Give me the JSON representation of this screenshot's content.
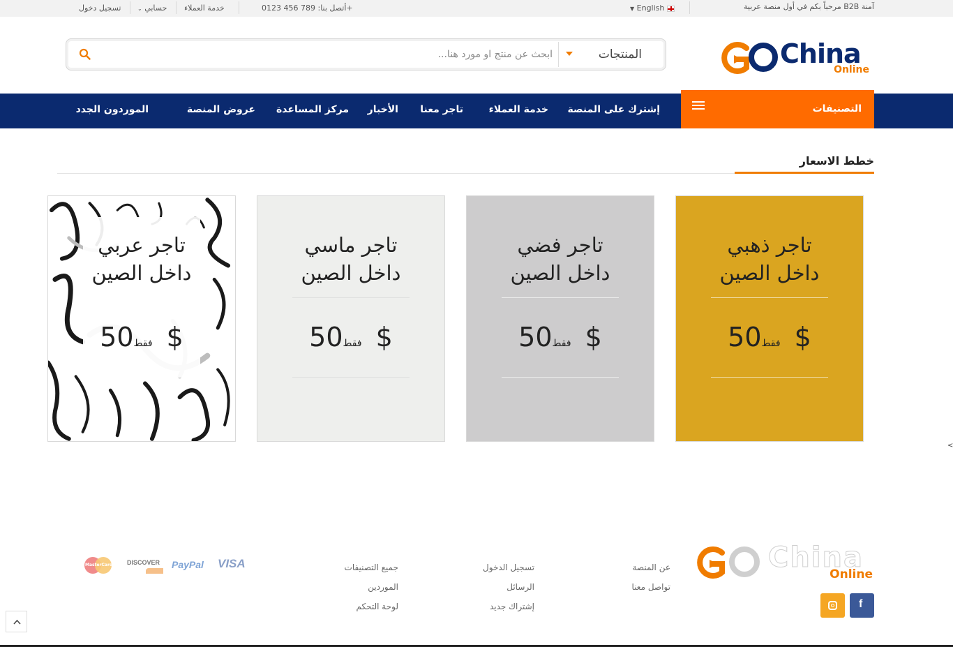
{
  "topbar": {
    "welcome": "مرحباً بكم في أول منصة عربية B2B آمنة",
    "language": "English",
    "contact": "أتصل بنا: 789 456 0123+",
    "customer_service": "خدمة العملاء",
    "my_account": "حسابي",
    "login": "تسجيل دخول"
  },
  "logo": {
    "go": "GO",
    "china": "China",
    "online": "Online"
  },
  "search": {
    "category": "المنتجات",
    "placeholder": "ابحث عن منتج او مورد هنا..."
  },
  "nav": {
    "categories": "التصنيفات",
    "items": [
      "إشترك على المنصة",
      "خدمة العملاء",
      "تاجر معنا",
      "الأخبار",
      "مركز المساعدة",
      "عروض المنصة",
      "الموردون الجدد"
    ]
  },
  "section": {
    "title": "خطط الاسعار"
  },
  "plans": [
    {
      "line1": "تاجر ذهبي",
      "line2": "داخل الصين",
      "price": "50 $",
      "note": "فقط",
      "color": "#daa520"
    },
    {
      "line1": "تاجر فضي",
      "line2": "داخل الصين",
      "price": "50 $",
      "note": "فقط",
      "color": "#cdcccd"
    },
    {
      "line1": "تاجر ماسي",
      "line2": "داخل الصين",
      "price": "50 $",
      "note": "فقط",
      "color": "#eeefed"
    },
    {
      "line1": "تاجر عربي",
      "line2": "داخل الصين",
      "price": "50 $",
      "note": "فقط",
      "color": "#ffffff"
    }
  ],
  "footer": {
    "col1": [
      "عن المنصة",
      "تواصل معنا"
    ],
    "col2": [
      "تسجيل الدخول",
      "الرسائل",
      "إشتراك جديد"
    ],
    "col3": [
      "جميع التصنيفات",
      "الموردين",
      "لوحة التحكم"
    ],
    "payments": [
      "VISA",
      "PayPal",
      "DISCOVER",
      "MasterCard"
    ],
    "social": [
      "facebook-icon",
      "instagram-icon"
    ]
  },
  "colors": {
    "navy": "#0b2a6f",
    "orange": "#ff6b00",
    "accent": "#f07c00"
  }
}
